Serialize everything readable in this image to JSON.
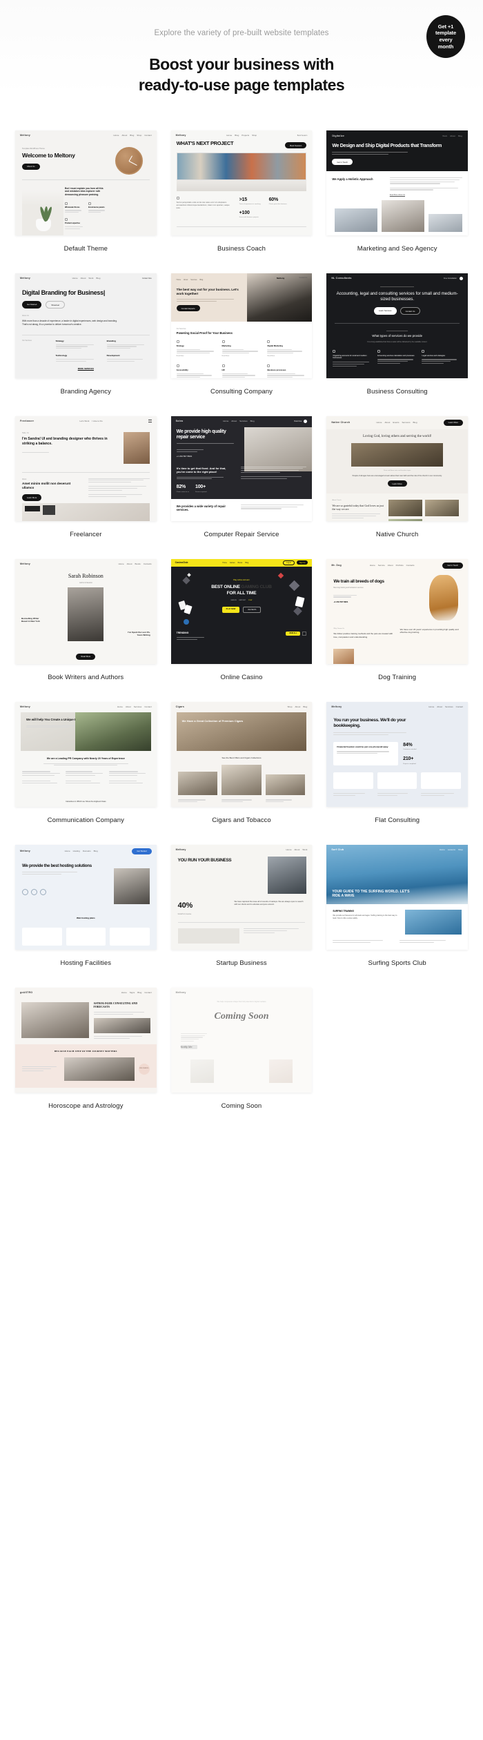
{
  "hero": {
    "eyebrow": "Explore the variety of pre-built website templates",
    "title_line1": "Boost your business with",
    "title_line2": "ready-to-use page templates",
    "badge": {
      "line1": "Get +1",
      "line2": "template",
      "line3": "every",
      "line4": "month"
    }
  },
  "colors": {
    "accent_dark": "#141414",
    "page_bg": "#ffffff",
    "muted_text": "#9b9b9b",
    "casino_yellow": "#f5e419"
  },
  "templates": [
    {
      "label": "Default Theme",
      "brand": "Meltony",
      "nav": [
        "Home",
        "About",
        "Blog",
        "Shop",
        "Contact"
      ],
      "nav_cta": "Contact Us",
      "eyebrow": "Template WordPress Theme",
      "heading": "Welcome to Meltony",
      "button": "About Us",
      "body": "But I must explain you how all this and mistaken idea explorer ruth denouncing pleasure praising.",
      "features": [
        "Wholesale Stores",
        "Ecommerce panels",
        "Product expertise"
      ]
    },
    {
      "label": "Business Coach",
      "brand": "Meltony",
      "nav": [
        "Home",
        "Blog",
        "Projects",
        "Shop",
        "Contacts"
      ],
      "nav_cta": "Book Session",
      "heading": "WHAT'S NEXT PROJECT",
      "body": "Sed ut perspiciatis unde omnis iste natus error sit voluptatem accusantium doloremque laudantium, totam rem aperiam, eaque ipsa.",
      "stats": [
        {
          "value": ">15",
          "caption": "Years of experience in coaching"
        },
        {
          "value": "60%",
          "caption": "Clients grow their business"
        },
        {
          "value": "+100",
          "caption": "Successful business projects"
        }
      ]
    },
    {
      "label": "Marketing and Seo Agency",
      "brand": "Digitalize",
      "heading": "We Design and Ship Digital Products that Transform",
      "button": "Get in Touch",
      "section_heading": "We Apply a Holistic Approach",
      "link": "Read More About Us"
    },
    {
      "label": "Branding Agency",
      "brand": "Meltony",
      "nav_cta": "Contact Now",
      "heading": "Digital Branding for Business|",
      "button": "Get Started",
      "button2": "Showreel",
      "eyebrow": "About Us",
      "body": "With more than a decade of experience, a leader in digital experiences, web design and branding. That's not abrag, it's a promise to deliver tomorrow's creative.",
      "services_label": "Our Services",
      "services": [
        "Strategy",
        "Branding",
        "Technology",
        "Development"
      ],
      "more_link": "MORE SERVICES"
    },
    {
      "label": "Consulting Company",
      "brand": "Meltony",
      "nav_cta": "Contact Us",
      "heading": "The best way out for your business. Let's work together!",
      "button": "Contact Experts",
      "section_eyebrow": "Our Services",
      "section_heading": "Powering Social Proof for Your Business",
      "services": [
        "Strategy",
        "Marketing",
        "Digital Marketing",
        "Accessibility",
        "HR",
        "Business processes"
      ],
      "more": "Read More"
    },
    {
      "label": "Business Consulting",
      "brand": "NL Consultants",
      "nav_cta": "Free Consultation",
      "heading": "Accounting, legal and consulting services for small and medium-sized businesses.",
      "button": "Learn Services",
      "button2": "Contact Us",
      "section_heading": "What types of services do we provide",
      "section_body": "It is a long established fact that a reader will be distracted by the readable content.",
      "cards": [
        "Organizing accounts for small and medium businesses",
        "Accounting services calculation and processes",
        "Legal services and strategies"
      ]
    },
    {
      "label": "Freelancer",
      "brand": "Freelancer",
      "eyebrow": "Hello, I'm",
      "heading": "I'm Sandra! UI and branding designer who thrives in striking a balance.",
      "section_eyebrow": "About",
      "section_heading": "Amet minim mollit non deserunt ullamco",
      "button": "Learn More"
    },
    {
      "label": "Computer Repair Service",
      "brand": "Solvo",
      "nav": [
        "Home",
        "About",
        "Services",
        "Blog",
        "Shop"
      ],
      "nav_cta": "Book Now",
      "heading": "We provide high quality repair service",
      "phone": "+1 234 567 8901",
      "section_heading": "It's time to get that fixed. And for that, you've come to the right place!",
      "stats": [
        {
          "value": "82%",
          "caption": "Clients return to us"
        },
        {
          "value": "100+",
          "caption": "Devices repaired"
        }
      ],
      "footer_heading": "We provides a wide variety of repair services."
    },
    {
      "label": "Native Church",
      "brand": "Native Church",
      "nav_cta": "Donate Now",
      "heading": "Loving God, loving others and serving the world!",
      "body": "People of all ages here are encouraged to learn about their own faith and the role of the church in our community.",
      "button": "Learn More",
      "section_heading": "We are so grateful today that God loves us just the way we are."
    },
    {
      "label": "Book Writers and Authors",
      "brand": "Meltony",
      "nav": [
        "Home",
        "About",
        "Books",
        "Contacts"
      ],
      "heading": "Sarah Robinson",
      "subheading": "Author & Novelist",
      "caption_left": "Bestselling Writer Based in New York",
      "caption_right": "I've Spent the Last 15+ Years Writing",
      "button": "Read More"
    },
    {
      "label": "Online Casino",
      "brand": "CasinoClub",
      "nav_cta": "Sign Up",
      "eyebrow": "Play online and earn",
      "heading_1": "BEST ONLINE",
      "heading_2": "GAMING CLUB",
      "heading_3": "FOR ALL TIME",
      "tabs": [
        "SIGN IN",
        "DEPOSIT",
        "PLAY"
      ],
      "button": "PLAY NOW",
      "button2": "REVIEWS",
      "section_heading": "TRENDING",
      "section_link": "VIEW ALL"
    },
    {
      "label": "Dog Training",
      "brand": "Mr. Dog",
      "nav": [
        "Home",
        "Service",
        "About",
        "Portfolio",
        "Contacts"
      ],
      "nav_cta": "Get in Touch",
      "heading": "We train all breeds of dogs",
      "body": "Best dog training and behaviour services",
      "phone": "+1 234 567 8901",
      "section_heading": "We follow positive training methods and the pets are treated with love, compassion and understanding.",
      "section_body": "We have over 20 years' experience in providing high quality and effective dog training."
    },
    {
      "label": "Communication Company",
      "brand": "Meltony",
      "heading": "We will help You Create a Unique Business",
      "section_heading": "We are a Leading PR Company with Nearly 20 Years of Experience",
      "footer_heading": "Industries in Which we Show the Highest Class"
    },
    {
      "label": "Cigars and Tobacco",
      "brand": "Cigars",
      "heading": "We Have a Great Collection of Premium Cigars",
      "section_heading": "See the Best Offers and Cigars Collections"
    },
    {
      "label": "Flat Consulting",
      "brand": "Meltony",
      "heading": "You run your business. We'll do your bookkeeping.",
      "card_heading": "Financial freedom could be just one phonecall away",
      "stats": [
        {
          "value": "84%",
          "caption": "Customers satisfied"
        },
        {
          "value": "210+",
          "caption": "Projects completed"
        }
      ]
    },
    {
      "label": "Hosting Facilities",
      "brand": "Meltony",
      "heading": "We provide the best hosting solutions",
      "section_heading": "Web hosting plans"
    },
    {
      "label": "Startup Business",
      "brand": "Meltony",
      "heading": "YOU RUN YOUR BUSINESS",
      "stat": {
        "value": "40%",
        "caption": "Growth in revenue"
      },
      "body": "We have captured the issue all of sounds of startups. We are always open to search with our clients and to educate everyone around."
    },
    {
      "label": "Surfing Sports Club",
      "brand": "Surf Club",
      "heading": "YOUR GUIDE TO THE SURFING WORLD. LET'S RIDE A WAVE",
      "section_heading": "SURFING TRAINING",
      "body": "We provide surf lessons for all levels and ages. Surfing training is the best way to learn how to ride a wave safely."
    },
    {
      "label": "Horoscope and Astrology",
      "brand": "goASTRO",
      "heading": "ASTROLOGER CONSULTING AND FORECASTS",
      "section_heading": "BECAUSE EACH STEP OF THE JOURNEY MATTERS",
      "badge": "FREE READING"
    },
    {
      "label": "Coming Soon",
      "brand": "Meltony",
      "eyebrow": "We help companies shape their full potential in digital markets",
      "heading": "Coming Soon",
      "button": "Notify Me"
    }
  ]
}
